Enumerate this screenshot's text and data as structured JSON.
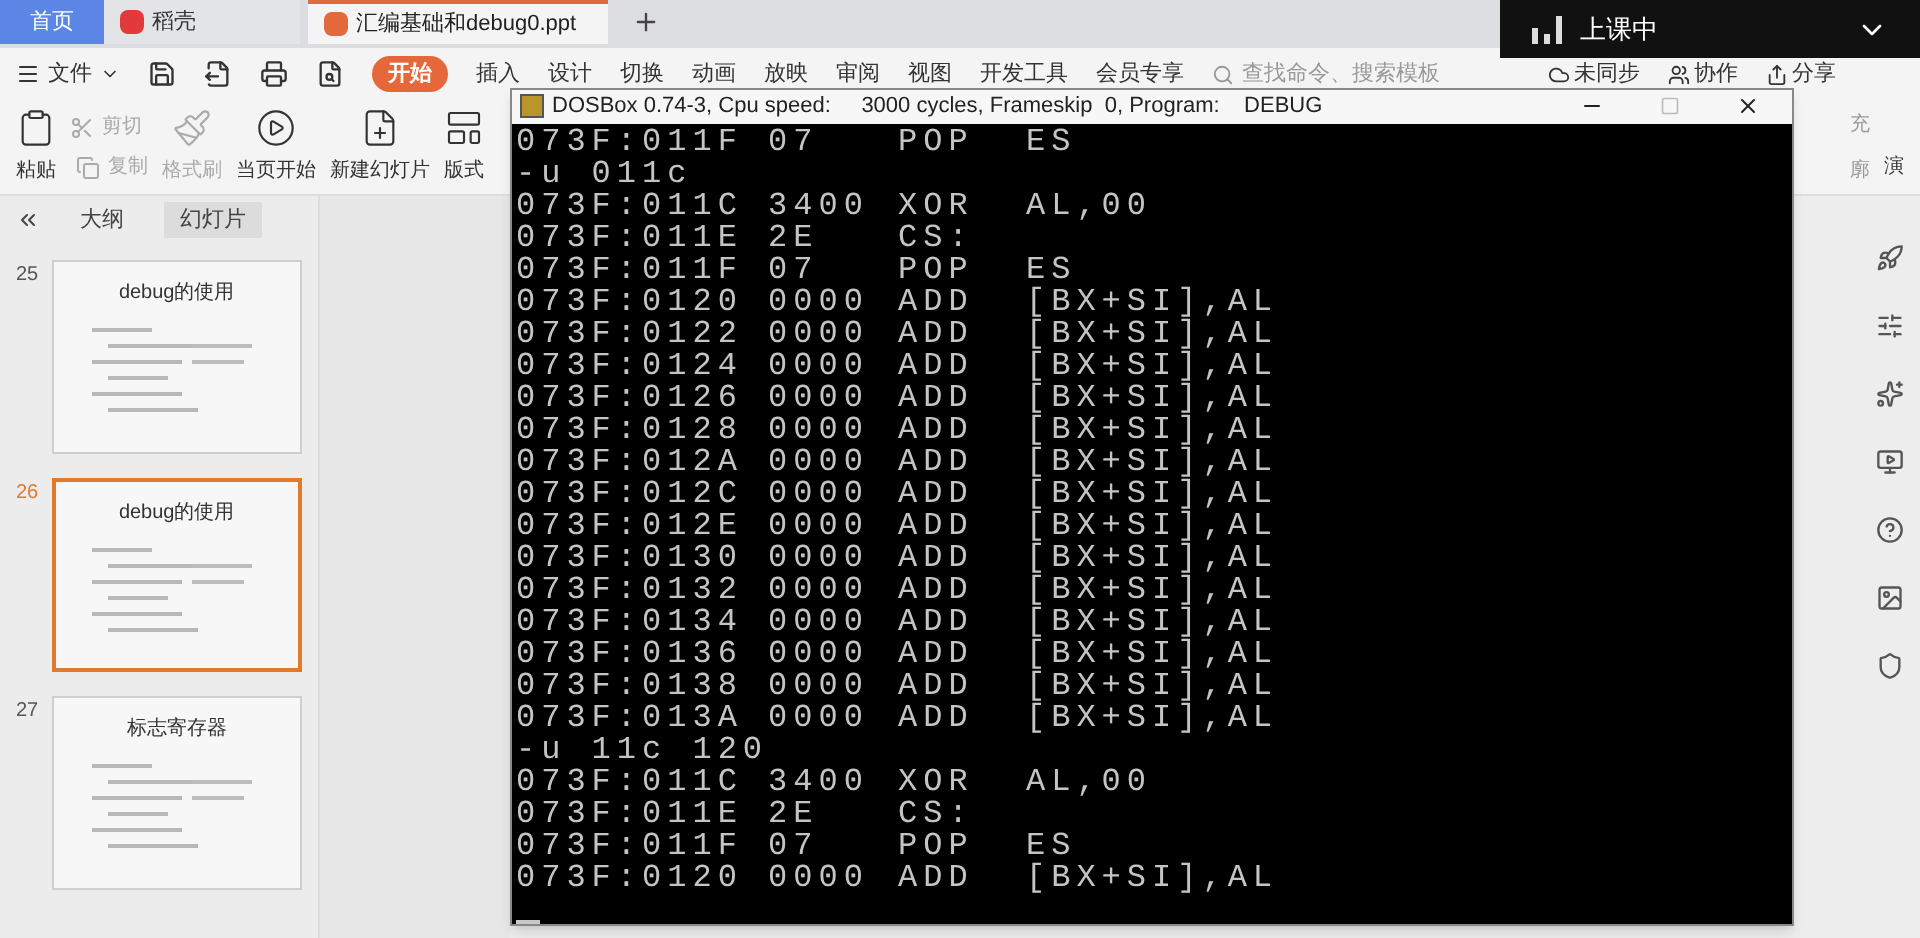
{
  "doc_tabs": [
    {
      "label": "首页",
      "kind": "home",
      "selected": false
    },
    {
      "label": "稻壳",
      "kind": "app",
      "selected": false
    },
    {
      "label": "汇编基础和debug0.ppt",
      "kind": "doc",
      "selected": true
    }
  ],
  "overlay": {
    "label": "上课中"
  },
  "menu": {
    "file": "文件",
    "tabs": [
      {
        "label": "开始",
        "selected": true
      },
      {
        "label": "插入",
        "selected": false
      },
      {
        "label": "设计",
        "selected": false
      },
      {
        "label": "切换",
        "selected": false
      },
      {
        "label": "动画",
        "selected": false
      },
      {
        "label": "放映",
        "selected": false
      },
      {
        "label": "审阅",
        "selected": false
      },
      {
        "label": "视图",
        "selected": false
      },
      {
        "label": "开发工具",
        "selected": false
      },
      {
        "label": "会员专享",
        "selected": false
      }
    ],
    "search": {
      "placeholder": "查找命令、搜索模板"
    },
    "actions": [
      "未同步",
      "协作",
      "分享"
    ]
  },
  "ribbon": [
    {
      "label": "粘贴",
      "kind": "big",
      "disabled": false
    },
    {
      "label": "剪切",
      "kind": "small",
      "disabled": true
    },
    {
      "label": "复制",
      "kind": "small",
      "disabled": true
    },
    {
      "label": "格式刷",
      "kind": "big",
      "disabled": true
    },
    {
      "label": "当页开始",
      "kind": "big",
      "disabled": false
    },
    {
      "label": "新建幻灯片",
      "kind": "big",
      "disabled": false
    },
    {
      "label": "版式",
      "kind": "big",
      "disabled": false
    }
  ],
  "ribbon_right": [
    "充",
    "廓",
    "演"
  ],
  "panel_tabs": [
    {
      "label": "大纲",
      "selected": false
    },
    {
      "label": "幻灯片",
      "selected": true
    }
  ],
  "slides": [
    {
      "number": "25",
      "title": "debug的使用",
      "selected": false
    },
    {
      "number": "26",
      "title": "debug的使用",
      "selected": true
    },
    {
      "number": "27",
      "title": "标志寄存器",
      "selected": false
    }
  ],
  "dosbox": {
    "title": "DOSBox 0.74-3, Cpu speed:     3000 cycles, Frameskip  0, Program:    DEBUG",
    "lines": [
      {
        "kind": "code",
        "address": "073F:011F 07",
        "op": "POP",
        "args": "ES"
      },
      {
        "kind": "command",
        "text": "-u 011c"
      },
      {
        "kind": "code",
        "address": "073F:011C 3400",
        "op": "XOR",
        "args": "AL,00"
      },
      {
        "kind": "code",
        "address": "073F:011E 2E",
        "op": "CS:"
      },
      {
        "kind": "code",
        "address": "073F:011F 07",
        "op": "POP",
        "args": "ES"
      },
      {
        "kind": "code",
        "address": "073F:0120 0000",
        "op": "ADD",
        "args": "[BX+SI],AL"
      },
      {
        "kind": "code",
        "address": "073F:0122 0000",
        "op": "ADD",
        "args": "[BX+SI],AL"
      },
      {
        "kind": "code",
        "address": "073F:0124 0000",
        "op": "ADD",
        "args": "[BX+SI],AL"
      },
      {
        "kind": "code",
        "address": "073F:0126 0000",
        "op": "ADD",
        "args": "[BX+SI],AL"
      },
      {
        "kind": "code",
        "address": "073F:0128 0000",
        "op": "ADD",
        "args": "[BX+SI],AL"
      },
      {
        "kind": "code",
        "address": "073F:012A 0000",
        "op": "ADD",
        "args": "[BX+SI],AL"
      },
      {
        "kind": "code",
        "address": "073F:012C 0000",
        "op": "ADD",
        "args": "[BX+SI],AL"
      },
      {
        "kind": "code",
        "address": "073F:012E 0000",
        "op": "ADD",
        "args": "[BX+SI],AL"
      },
      {
        "kind": "code",
        "address": "073F:0130 0000",
        "op": "ADD",
        "args": "[BX+SI],AL"
      },
      {
        "kind": "code",
        "address": "073F:0132 0000",
        "op": "ADD",
        "args": "[BX+SI],AL"
      },
      {
        "kind": "code",
        "address": "073F:0134 0000",
        "op": "ADD",
        "args": "[BX+SI],AL"
      },
      {
        "kind": "code",
        "address": "073F:0136 0000",
        "op": "ADD",
        "args": "[BX+SI],AL"
      },
      {
        "kind": "code",
        "address": "073F:0138 0000",
        "op": "ADD",
        "args": "[BX+SI],AL"
      },
      {
        "kind": "code",
        "address": "073F:013A 0000",
        "op": "ADD",
        "args": "[BX+SI],AL"
      },
      {
        "kind": "command",
        "text": "-u 11c 120"
      },
      {
        "kind": "code",
        "address": "073F:011C 3400",
        "op": "XOR",
        "args": "AL,00"
      },
      {
        "kind": "code",
        "address": "073F:011E 2E",
        "op": "CS:"
      },
      {
        "kind": "code",
        "address": "073F:011F 07",
        "op": "POP",
        "args": "ES"
      },
      {
        "kind": "code",
        "address": "073F:0120 0000",
        "op": "ADD",
        "args": "[BX+SI],AL"
      },
      {
        "kind": "cursor"
      }
    ]
  }
}
